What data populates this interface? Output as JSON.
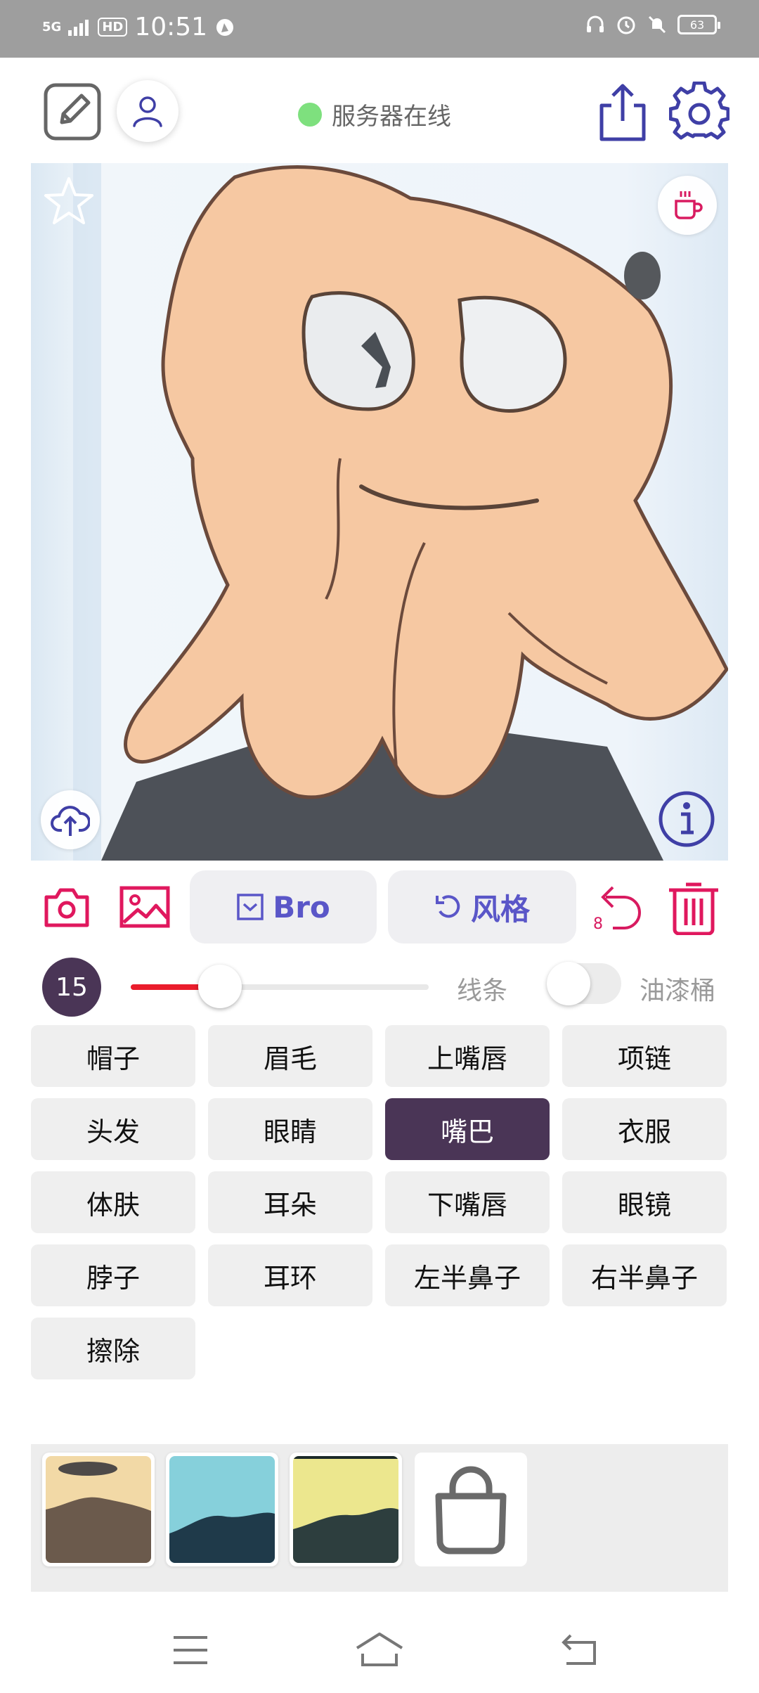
{
  "status_bar": {
    "network": "5G",
    "hd": "HD",
    "time": "10:51",
    "battery": "63"
  },
  "header": {
    "server_status": "服务器在线",
    "status_color": "#7ee07e"
  },
  "toolbar": {
    "bro_label": "Bro",
    "style_label": "风格",
    "undo_count": "8"
  },
  "brush": {
    "size": "15",
    "size_level": 0.3,
    "line_label": "线条",
    "bucket_label": "油漆桶",
    "bucket_enabled": false
  },
  "parts": [
    {
      "label": "帽子",
      "active": false
    },
    {
      "label": "眉毛",
      "active": false
    },
    {
      "label": "上嘴唇",
      "active": false
    },
    {
      "label": "项链",
      "active": false
    },
    {
      "label": "头发",
      "active": false
    },
    {
      "label": "眼睛",
      "active": false
    },
    {
      "label": "嘴巴",
      "active": true
    },
    {
      "label": "衣服",
      "active": false
    },
    {
      "label": "体肤",
      "active": false
    },
    {
      "label": "耳朵",
      "active": false
    },
    {
      "label": "下嘴唇",
      "active": false
    },
    {
      "label": "眼镜",
      "active": false
    },
    {
      "label": "脖子",
      "active": false
    },
    {
      "label": "耳环",
      "active": false
    },
    {
      "label": "左半鼻子",
      "active": false
    },
    {
      "label": "右半鼻子",
      "active": false
    },
    {
      "label": "擦除",
      "active": false
    }
  ],
  "colors": {
    "accent": "#5a56c8",
    "danger": "#e0185e",
    "active_chip": "#4a3556",
    "slider": "#ea1d2c"
  }
}
